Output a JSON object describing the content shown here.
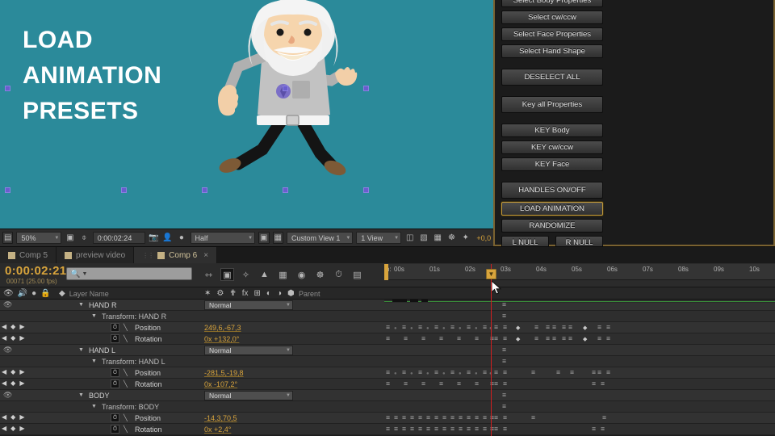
{
  "viewer": {
    "title_lines": [
      "LOAD",
      "ANIMATION",
      "PRESETS"
    ],
    "background_color": "#2b8a9a",
    "handle_color": "#6a5ecd"
  },
  "viewer_toolbar": {
    "magnification": "50%",
    "timecode": "0:00:02:24",
    "resolution": "Half",
    "view_preset": "Custom View 1",
    "view_count": "1 View",
    "offset": "+0,0",
    "icons": [
      "always-preview-icon",
      "region-of-interest-icon",
      "mask-toggle-icon",
      "snapshot-icon",
      "show-snapshot-icon",
      "channel-icon",
      "toggle-transparency-icon",
      "toggle-alpha-grid-icon",
      "timeline-marker-icon",
      "render-queue-icon",
      "comp-flowchart-icon",
      "draft-3d-icon",
      "fast-previews-icon"
    ]
  },
  "script_panel": {
    "border_color": "#7a6230",
    "buttons": [
      {
        "label": "Select Body Properties",
        "style": "normal",
        "clipped": true
      },
      {
        "label": "Select cw/ccw",
        "style": "normal"
      },
      {
        "label": "Select Face Properties",
        "style": "normal"
      },
      {
        "label": "Select Hand Shape",
        "style": "normal"
      },
      {
        "label": "DESELECT ALL",
        "style": "tall"
      },
      {
        "label": "Key all Properties",
        "style": "tall"
      },
      {
        "label": "KEY Body",
        "style": "normal"
      },
      {
        "label": "KEY cw/ccw",
        "style": "normal"
      },
      {
        "label": "KEY Face",
        "style": "normal"
      },
      {
        "label": "HANDLES ON/OFF",
        "style": "tall"
      },
      {
        "label": "LOAD ANIMATION",
        "style": "selected"
      },
      {
        "label": "RANDOMIZE",
        "style": "normal"
      }
    ],
    "null_buttons": [
      "L NULL",
      "R NULL"
    ]
  },
  "tabs": [
    {
      "label": "Comp 5",
      "active": false,
      "closable": false
    },
    {
      "label": "preview video",
      "active": false,
      "closable": false
    },
    {
      "label": "Comp 6",
      "active": true,
      "closable": true,
      "close_label": "×"
    }
  ],
  "timeline": {
    "current_time": "0:00:02:21",
    "frame_info": "00071 (25.00 fps)",
    "search_placeholder": "",
    "ruler_ticks": [
      "00s",
      "01s",
      "02s",
      "03s",
      "04s",
      "05s",
      "06s",
      "07s",
      "08s",
      "09s",
      "10s"
    ],
    "ruler_prefix": "h:",
    "playhead_time_label": "",
    "columns": {
      "layer_name": "Layer Name",
      "parent": "Parent",
      "switch_glyphs": [
        "✶",
        "⚙",
        "╲",
        "fx",
        "⊞",
        "◐",
        "◑",
        "⬢"
      ],
      "av_glyphs": [
        "◉",
        "◀))",
        "●",
        "ὑ2"
      ]
    },
    "layers": [
      {
        "type": "layer",
        "name": "HAND R",
        "mode": "Normal",
        "visible": true,
        "keys": [
          50
        ]
      },
      {
        "type": "group",
        "name": "Transform: HAND R",
        "keys": [
          50
        ]
      },
      {
        "type": "property",
        "name": "Position",
        "value": "249,6,-67,3",
        "keys": [
          2,
          12,
          22,
          32,
          42,
          52,
          62,
          68,
          81,
          98,
          120,
          131,
          139,
          149,
          157,
          181,
          203,
          215
        ],
        "dots": [
          7,
          17,
          27,
          37,
          47,
          57,
          64
        ]
      },
      {
        "type": "property",
        "name": "Rotation",
        "value": "0x +132,0°",
        "keys": [
          2,
          23,
          43,
          63,
          84,
          105,
          126,
          139,
          149,
          157,
          181,
          203,
          215
        ],
        "dots": []
      },
      {
        "type": "layer",
        "name": "HAND L",
        "mode": "Normal",
        "visible": true,
        "keys": [
          50
        ]
      },
      {
        "type": "group",
        "name": "Transform: HAND L",
        "keys": [
          50
        ]
      },
      {
        "type": "property",
        "name": "Position",
        "value": "-281,5,-19,8",
        "keys": [
          2,
          12,
          22,
          32,
          42,
          52,
          62,
          68,
          81,
          98,
          120,
          131,
          139,
          149,
          157,
          181,
          203,
          215
        ],
        "dots": [
          7,
          17,
          27,
          37,
          47,
          57,
          64
        ]
      },
      {
        "type": "property",
        "name": "Rotation",
        "value": "0x -107,2°",
        "keys": [
          2,
          23,
          43,
          63,
          84,
          105,
          126,
          139,
          149,
          157,
          181,
          203,
          215
        ],
        "dots": []
      },
      {
        "type": "layer",
        "name": "BODY",
        "mode": "Normal",
        "visible": true,
        "keys": [
          50
        ]
      },
      {
        "type": "group",
        "name": "Transform: BODY",
        "keys": [
          50
        ]
      },
      {
        "type": "property",
        "name": "Position",
        "value": "-14,3,70,5",
        "keys": [
          2,
          12,
          22,
          32,
          42,
          52,
          62,
          68,
          81,
          98,
          120,
          131,
          139,
          149,
          157,
          181,
          203,
          215
        ],
        "dots": []
      },
      {
        "type": "property",
        "name": "Rotation",
        "value": "0x +2,4°",
        "keys": [
          2,
          23,
          43,
          63,
          84,
          105,
          126,
          139,
          149,
          157,
          181,
          203,
          215
        ],
        "dots": []
      }
    ]
  }
}
